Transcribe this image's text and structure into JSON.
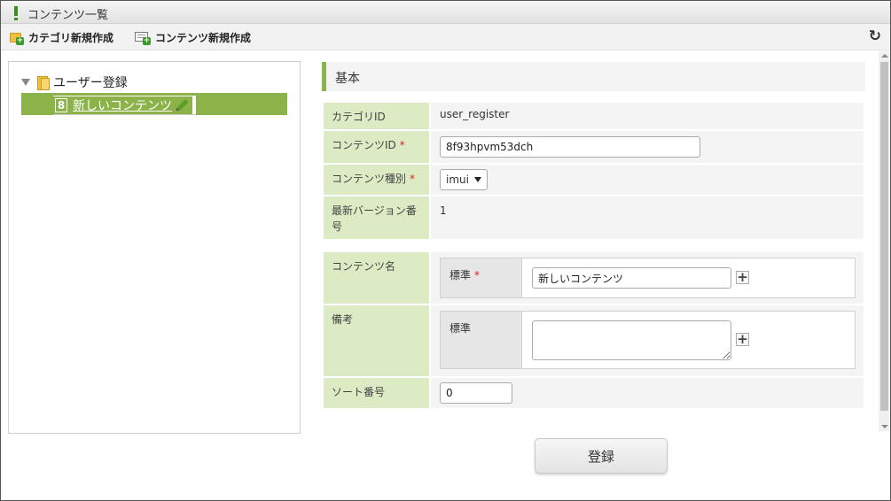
{
  "window": {
    "title": "コンテンツ一覧"
  },
  "toolbar": {
    "new_category_label": "カテゴリ新規作成",
    "new_content_label": "コンテンツ新規作成",
    "refresh_icon": "refresh-icon"
  },
  "tree": {
    "root_label": "ユーザー登録",
    "selected_child": {
      "badge": "8",
      "label": "新しいコンテンツ",
      "selected": true
    },
    "highlight_color": "#8bb34a"
  },
  "form": {
    "section_title": "基本",
    "category_id": {
      "label": "カテゴリID",
      "value": "user_register"
    },
    "content_id": {
      "label": "コンテンツID",
      "required_mark": "*",
      "value": "8f93hpvm53dch"
    },
    "content_type": {
      "label": "コンテンツ種別",
      "required_mark": "*",
      "selected": "imui"
    },
    "latest_version": {
      "label": "最新バージョン番号",
      "value": "1"
    },
    "content_name": {
      "label": "コンテンツ名",
      "lang_label": "標準",
      "required_mark": "*",
      "value": "新しいコンテンツ"
    },
    "note": {
      "label": "備考",
      "lang_label": "標準",
      "value": ""
    },
    "sort_no": {
      "label": "ソート番号",
      "value": "0"
    },
    "submit_label": "登録"
  },
  "colors": {
    "accent": "#8bb34a",
    "header_cell": "#dcebc4",
    "required": "#e02020"
  }
}
